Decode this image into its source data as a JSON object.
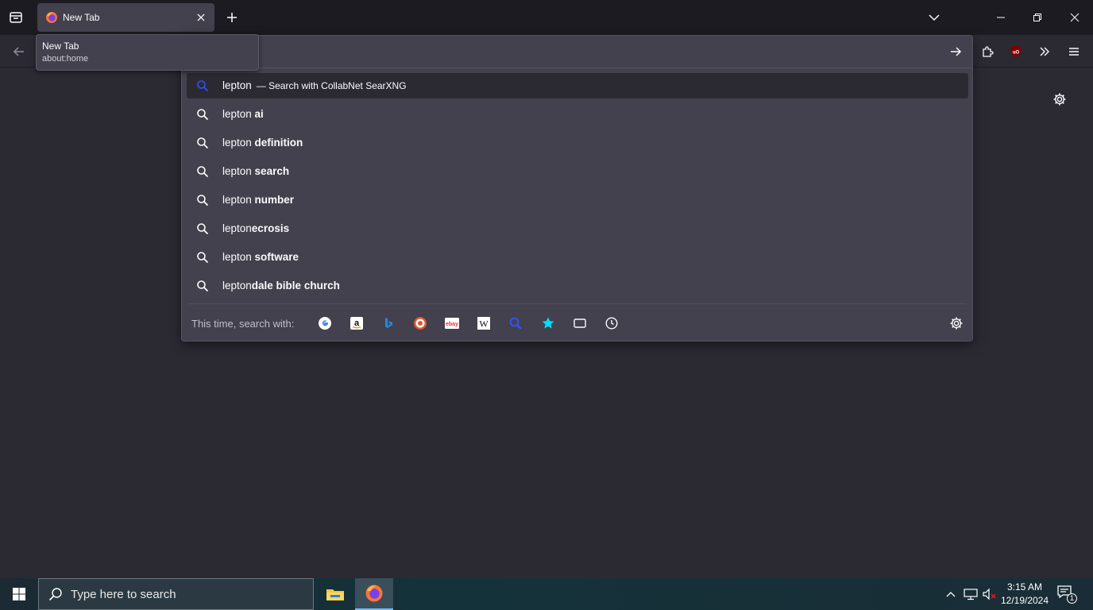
{
  "tab": {
    "title": "New Tab"
  },
  "tooltip": {
    "title": "New Tab",
    "url": "about:home"
  },
  "urlbar": {
    "value": ""
  },
  "results": [
    {
      "prefix": "lepton",
      "suffix": "",
      "action": "— Search with CollabNet SearXNG",
      "selected": true
    },
    {
      "prefix": "lepton ",
      "suffix": "ai"
    },
    {
      "prefix": "lepton ",
      "suffix": "definition"
    },
    {
      "prefix": "lepton ",
      "suffix": "search"
    },
    {
      "prefix": "lepton ",
      "suffix": "number"
    },
    {
      "prefix": "lepton",
      "suffix": "ecrosis"
    },
    {
      "prefix": "lepton ",
      "suffix": "software"
    },
    {
      "prefix": "lepton",
      "suffix": "dale bible church"
    }
  ],
  "oneoff": {
    "label": "This time, search with:",
    "engines": [
      "google-icon",
      "amazon-icon",
      "bing-icon",
      "duckduckgo-icon",
      "ebay-icon",
      "wikipedia-icon",
      "searxng-icon",
      "bookmarks-icon",
      "tabs-icon",
      "history-icon"
    ]
  },
  "taskbar": {
    "search_placeholder": "Type here to search",
    "time": "3:15 AM",
    "date": "12/19/2024",
    "notifications": "1"
  },
  "colors": {
    "accent_blue": "#0060df",
    "ublock_red": "#800000",
    "firefox_orange": "#ff7139"
  }
}
